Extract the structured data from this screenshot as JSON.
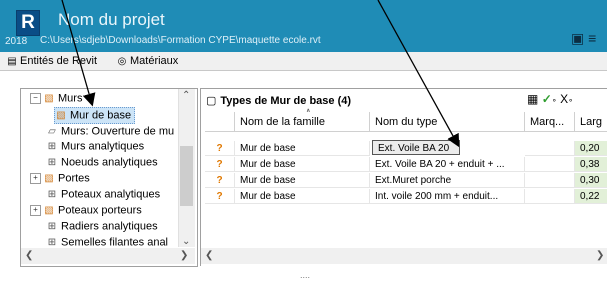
{
  "header": {
    "logo": "R",
    "project_name": "Nom du projet",
    "year": "2018",
    "path": "C:\\Users\\sdjeb\\Downloads\\Formation CYPE\\maquette ecole.rvt",
    "icons": [
      "panel-icon",
      "menu-icon"
    ]
  },
  "tabs": [
    {
      "label": "Entités de Revit",
      "icon": "window-icon"
    },
    {
      "label": "Matériaux",
      "icon": "material-sphere-icon"
    }
  ],
  "tree": {
    "items": [
      {
        "label": "Murs",
        "expander": "−",
        "icon": "wall-type-icon"
      },
      {
        "label": "Mur de base",
        "icon": "wall-type-icon",
        "selected": true
      },
      {
        "label": "Murs: Ouverture de mu",
        "icon": "opening-icon"
      },
      {
        "label": "Murs analytiques",
        "icon": "analytical-icon"
      },
      {
        "label": "Noeuds analytiques",
        "icon": "analytical-icon"
      },
      {
        "label": "Portes",
        "expander": "+",
        "icon": "door-icon"
      },
      {
        "label": "Poteaux analytiques",
        "icon": "analytical-icon"
      },
      {
        "label": "Poteaux porteurs",
        "expander": "+",
        "icon": "column-icon"
      },
      {
        "label": "Radiers analytiques",
        "icon": "analytical-icon"
      },
      {
        "label": "Semelles filantes anal",
        "icon": "analytical-icon"
      }
    ]
  },
  "grid": {
    "title": "Types de Mur de base (4)",
    "tools": [
      "edit-table-icon",
      "check-icon",
      "clear-icon"
    ],
    "columns": [
      "Nom de la famille",
      "Nom du type",
      "Marq...",
      "Larg"
    ],
    "rows": [
      {
        "status": "?",
        "family": "Mur de base",
        "type": "Ext. Voile BA 20",
        "mark": "",
        "width": "0,20",
        "selected": true
      },
      {
        "status": "?",
        "family": "Mur de base",
        "type": "Ext. Voile BA 20 + enduit + ...",
        "mark": "",
        "width": "0,38"
      },
      {
        "status": "?",
        "family": "Mur de base",
        "type": "Ext.Muret porche",
        "mark": "",
        "width": "0,30"
      },
      {
        "status": "?",
        "family": "Mur de base",
        "type": "Int. voile 200 mm + enduit...",
        "mark": "",
        "width": "0,22"
      }
    ]
  },
  "splitter": "....",
  "colors": {
    "header": "#1f8cb6",
    "status": "#e07800",
    "width_cell": "#e2f0d8",
    "selection": "#cce4f7"
  }
}
